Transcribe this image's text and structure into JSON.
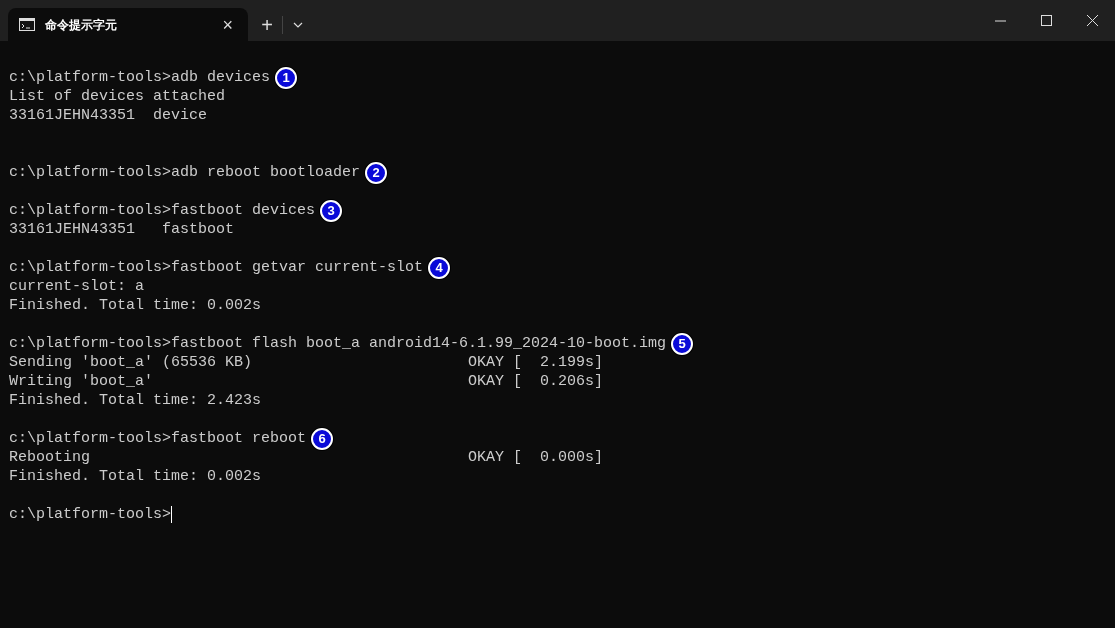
{
  "tab": {
    "title": "命令提示字元",
    "selected": true,
    "close": "×"
  },
  "new_tab": "+",
  "lines": [
    {
      "kind": "text",
      "text": "c:\\platform-tools>adb devices",
      "marker": "1"
    },
    {
      "kind": "text",
      "text": "List of devices attached"
    },
    {
      "kind": "text",
      "text": "33161JEHN43351  device"
    },
    {
      "kind": "blank"
    },
    {
      "kind": "blank"
    },
    {
      "kind": "text",
      "text": "c:\\platform-tools>adb reboot bootloader",
      "marker": "2"
    },
    {
      "kind": "blank"
    },
    {
      "kind": "text",
      "text": "c:\\platform-tools>fastboot devices",
      "marker": "3"
    },
    {
      "kind": "text",
      "text": "33161JEHN43351   fastboot"
    },
    {
      "kind": "blank"
    },
    {
      "kind": "text",
      "text": "c:\\platform-tools>fastboot getvar current-slot",
      "marker": "4"
    },
    {
      "kind": "text",
      "text": "current-slot: a"
    },
    {
      "kind": "text",
      "text": "Finished. Total time: 0.002s"
    },
    {
      "kind": "blank"
    },
    {
      "kind": "text",
      "text": "c:\\platform-tools>fastboot flash boot_a android14-6.1.99_2024-10-boot.img",
      "marker": "5"
    },
    {
      "kind": "text",
      "text": "Sending 'boot_a' (65536 KB)",
      "status": "OKAY [  2.199s]"
    },
    {
      "kind": "text",
      "text": "Writing 'boot_a'",
      "status": "OKAY [  0.206s]"
    },
    {
      "kind": "text",
      "text": "Finished. Total time: 2.423s"
    },
    {
      "kind": "blank"
    },
    {
      "kind": "text",
      "text": "c:\\platform-tools>fastboot reboot",
      "marker": "6"
    },
    {
      "kind": "text",
      "text": "Rebooting",
      "status": "OKAY [  0.000s]"
    },
    {
      "kind": "text",
      "text": "Finished. Total time: 0.002s"
    },
    {
      "kind": "blank"
    },
    {
      "kind": "prompt",
      "text": "c:\\platform-tools>",
      "cursor": true
    }
  ]
}
